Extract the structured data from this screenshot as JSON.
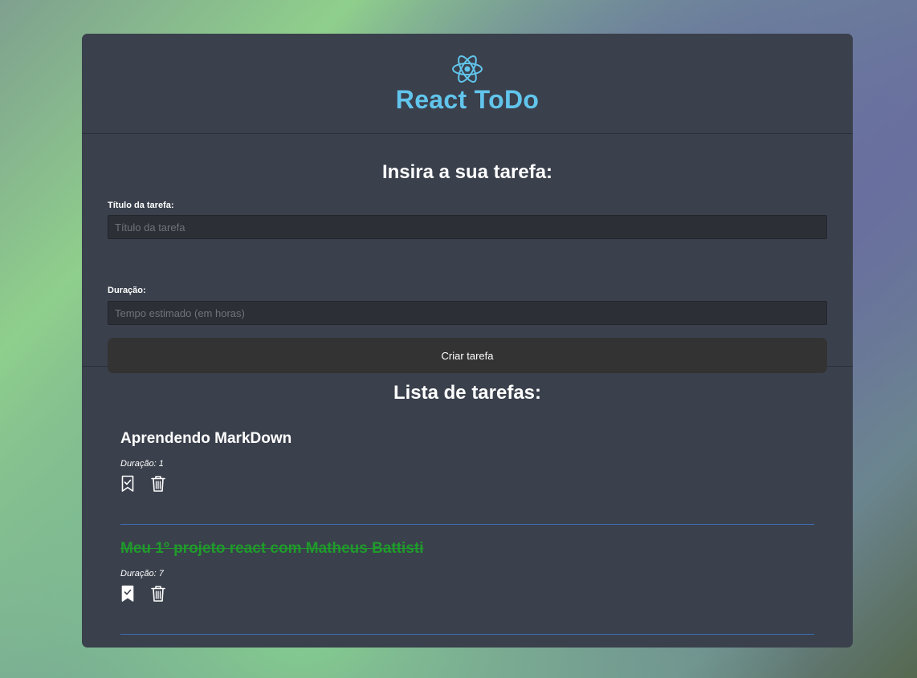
{
  "header": {
    "title": "React ToDo",
    "logo_icon": "react-atom-icon",
    "accent_color": "#61c5ec"
  },
  "form": {
    "heading": "Insira a sua tarefa:",
    "title_label": "Título da tarefa:",
    "title_placeholder": "Título da tarefa",
    "title_value": "",
    "duration_label": "Duração:",
    "duration_placeholder": "Tempo estimado (em horas)",
    "duration_value": "",
    "submit_label": "Criar tarefa"
  },
  "list": {
    "heading": "Lista de tarefas:",
    "tasks": [
      {
        "title": "Aprendendo MarkDown",
        "duration": "Duração: 1",
        "done": false,
        "done_color": "#1f9a2b"
      },
      {
        "title": "Meu 1º projeto react com Matheus Battisti",
        "duration": "Duração: 7",
        "done": true,
        "done_color": "#1f9a2b"
      }
    ]
  }
}
